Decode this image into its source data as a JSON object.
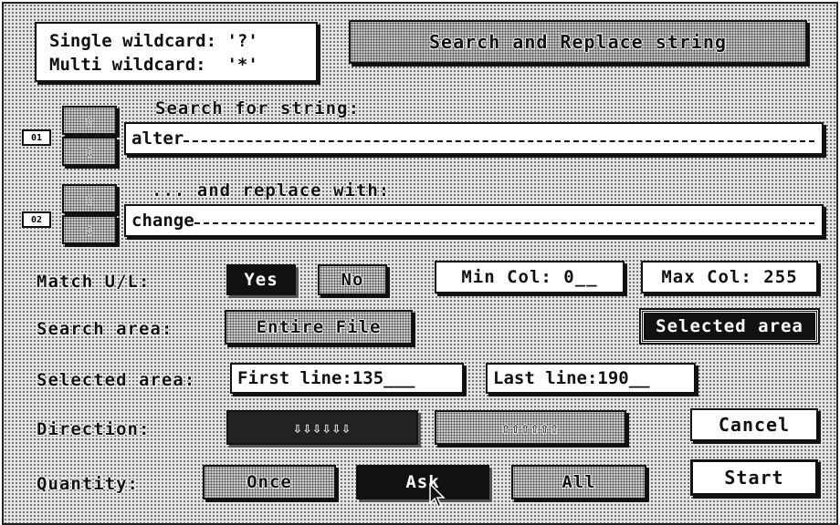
{
  "wildcards": {
    "single": "Single wildcard: '?'",
    "multi": "Multi wildcard:  '*'"
  },
  "title": "Search and Replace string",
  "search": {
    "tag": "01",
    "label": "Search for string:",
    "value": "alter",
    "up_icon": "arrow-up-icon",
    "down_icon": "arrow-down-icon"
  },
  "replace": {
    "tag": "02",
    "label": "... and replace with:",
    "value": "change"
  },
  "match": {
    "label": "Match U/L:",
    "yes": "Yes",
    "no": "No",
    "min_col": "Min Col: 0__",
    "max_col": "Max Col: 255"
  },
  "search_area": {
    "label": "Search area:",
    "entire": "Entire File",
    "selected": "Selected area"
  },
  "selected_area": {
    "label": "Selected area:",
    "first_line": "First line:135___",
    "last_line": "Last line:190__"
  },
  "direction": {
    "label": "Direction:",
    "down_arrows": "⇩⇩⇩⇩⇩⇩",
    "up_arrows": "⇧⇧⇧⇧⇧⇧",
    "cancel": "Cancel"
  },
  "quantity": {
    "label": "Quantity:",
    "once": "Once",
    "ask": "Ask",
    "all": "All",
    "start": "Start"
  },
  "colors": {
    "ink": "#111111",
    "paper": "#ffffff"
  }
}
